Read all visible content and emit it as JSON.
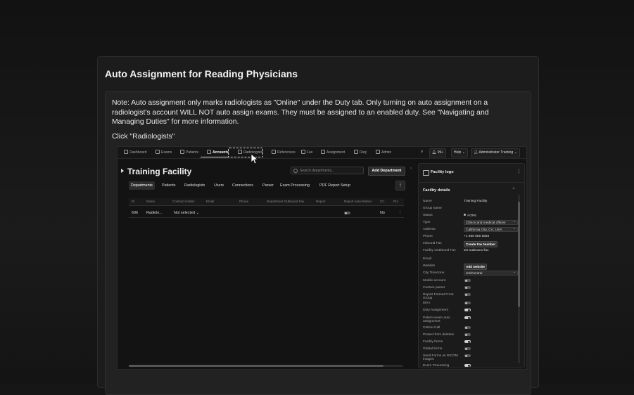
{
  "card": {
    "title": "Auto Assignment for Reading Physicians",
    "note": "Note: Auto assignment only marks radiologists as \"Online\" under the Duty tab. Only turning on auto assignment on a radiologist's account WILL NOT auto assign exams. They must be assigned to an enabled duty. See \"Navigating and Managing Duties\" for more information.",
    "instruction": "Click \"Radiologists\""
  },
  "screenshot": {
    "nav": [
      {
        "label": "Dashboard",
        "icon": "grid-icon"
      },
      {
        "label": "Exams",
        "icon": "list-icon"
      },
      {
        "label": "Patients",
        "icon": "patients-icon"
      },
      {
        "label": "Accounts",
        "icon": "building-icon",
        "active": true
      },
      {
        "label": "Radiologists",
        "icon": "user-icon",
        "highlighted": true
      },
      {
        "label": "References",
        "icon": "references-icon"
      },
      {
        "label": "Fax",
        "icon": "fax-icon"
      },
      {
        "label": "Assignment",
        "icon": "assignment-icon"
      },
      {
        "label": "Duty",
        "icon": "duty-icon"
      },
      {
        "label": "Admin",
        "icon": "gear-icon"
      }
    ],
    "topbar": {
      "notifications": "99+",
      "help": "Help",
      "user": "Administrator Training"
    },
    "facility_title": "Training Facility",
    "search_placeholder": "Search departments...",
    "add_department": "Add Department",
    "tabs": [
      "Departments",
      "Patients",
      "Radiologists",
      "Users",
      "Connections",
      "Parser",
      "Exam Processing",
      "PDF Report Setup"
    ],
    "table": {
      "headers": [
        "ID",
        "Name",
        "Contract Holder",
        "Email",
        "Phone",
        "Department Outbound Fax",
        "Report",
        "Report Auto-Deliver",
        "CC",
        "Pro"
      ],
      "row": {
        "id": "696",
        "name": "Radiolo...",
        "contract_holder": "Not selected",
        "auto_deliver": false,
        "cc": "No"
      }
    },
    "panel": {
      "logo_label": "Facility logo",
      "section": "Facility details",
      "fields": [
        {
          "label": "Name",
          "type": "text",
          "value": "Training Facility"
        },
        {
          "label": "Group name",
          "type": "text",
          "value": ""
        },
        {
          "label": "Status",
          "type": "status",
          "value": "Active"
        },
        {
          "label": "Type",
          "type": "select",
          "value": "Clinics and medical offices"
        },
        {
          "label": "Address",
          "type": "select",
          "value": "California City, CA, USA"
        },
        {
          "label": "Phone",
          "type": "text",
          "value": "+1 555 555 5555"
        },
        {
          "label": "Inbound Fax",
          "type": "button",
          "value": "Create Fax Number"
        },
        {
          "label": "Facility Outbound Fax",
          "type": "text",
          "value": "set outbound fax"
        },
        {
          "label": "Email",
          "type": "text",
          "value": ""
        },
        {
          "label": "Website",
          "type": "button",
          "value": "Add website"
        },
        {
          "label": "City Timezone",
          "type": "select",
          "value": "US/Central"
        },
        {
          "label": "Mobile account",
          "type": "toggle",
          "on": false
        },
        {
          "label": "Custom parser",
          "type": "toggle",
          "on": false
        },
        {
          "label": "Report Format Front Group",
          "type": "toggle",
          "on": false
        },
        {
          "label": "MAA",
          "type": "toggle",
          "on": false
        },
        {
          "label": "Duty Assignment",
          "type": "toggle",
          "on": true
        },
        {
          "label": "Patient exam auto assignment",
          "type": "toggle",
          "on": true
        },
        {
          "label": "Critical Call",
          "type": "toggle",
          "on": false
        },
        {
          "label": "Protect from deletion",
          "type": "toggle",
          "on": false
        },
        {
          "label": "Facility forms",
          "type": "toggle",
          "on": true
        },
        {
          "label": "Global forms",
          "type": "toggle",
          "on": false
        },
        {
          "label": "Send Forms as DICOM images",
          "type": "toggle",
          "on": false
        },
        {
          "label": "Exam Processing",
          "type": "toggle",
          "on": true
        }
      ]
    }
  }
}
